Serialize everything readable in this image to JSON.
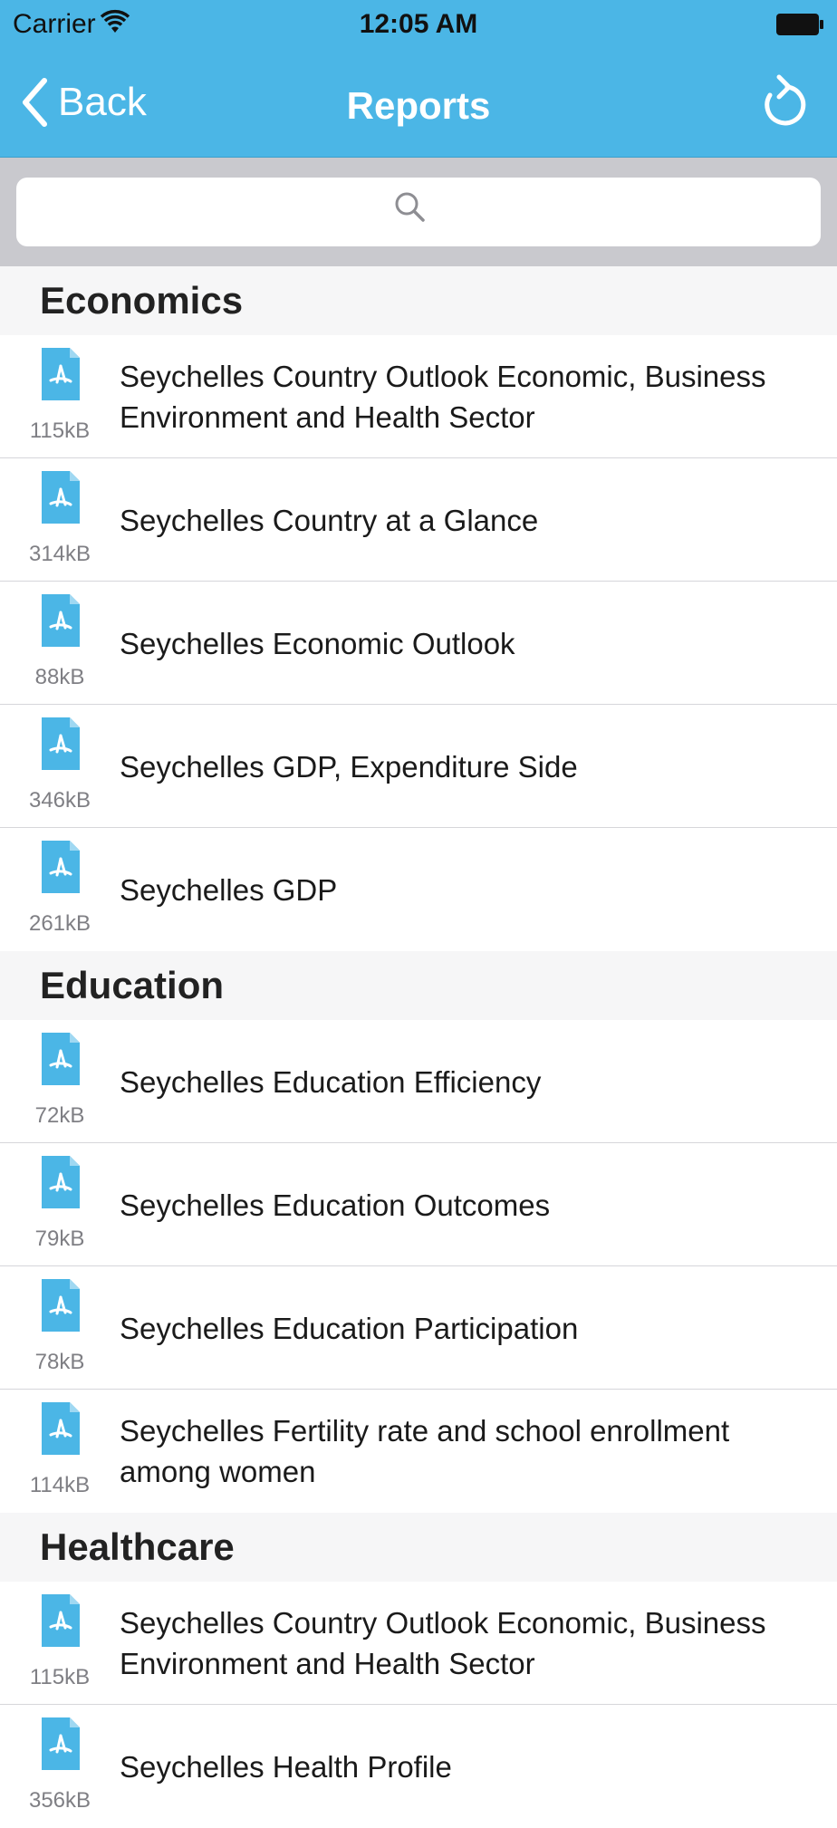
{
  "status_bar": {
    "carrier": "Carrier",
    "time": "12:05 AM"
  },
  "nav_bar": {
    "back_label": "Back",
    "title": "Reports"
  },
  "search": {
    "placeholder": ""
  },
  "colors": {
    "brand": "#4bb6e6",
    "section_bg": "#f6f6f7",
    "search_bg": "#c9c9ce"
  },
  "sections": [
    {
      "title": "Economics",
      "items": [
        {
          "size": "115kB",
          "title": "Seychelles Country Outlook Economic, Business Environment and Health Sector"
        },
        {
          "size": "314kB",
          "title": "Seychelles Country at a Glance"
        },
        {
          "size": "88kB",
          "title": "Seychelles Economic Outlook"
        },
        {
          "size": "346kB",
          "title": "Seychelles GDP, Expenditure Side"
        },
        {
          "size": "261kB",
          "title": "Seychelles GDP"
        }
      ]
    },
    {
      "title": "Education",
      "items": [
        {
          "size": "72kB",
          "title": "Seychelles Education Efficiency"
        },
        {
          "size": "79kB",
          "title": "Seychelles Education Outcomes"
        },
        {
          "size": "78kB",
          "title": "Seychelles Education Participation"
        },
        {
          "size": "114kB",
          "title": "Seychelles Fertility rate and school enrollment among women"
        }
      ]
    },
    {
      "title": "Healthcare",
      "items": [
        {
          "size": "115kB",
          "title": "Seychelles Country Outlook Economic, Business Environment and Health Sector"
        },
        {
          "size": "356kB",
          "title": "Seychelles Health Profile"
        }
      ]
    }
  ]
}
